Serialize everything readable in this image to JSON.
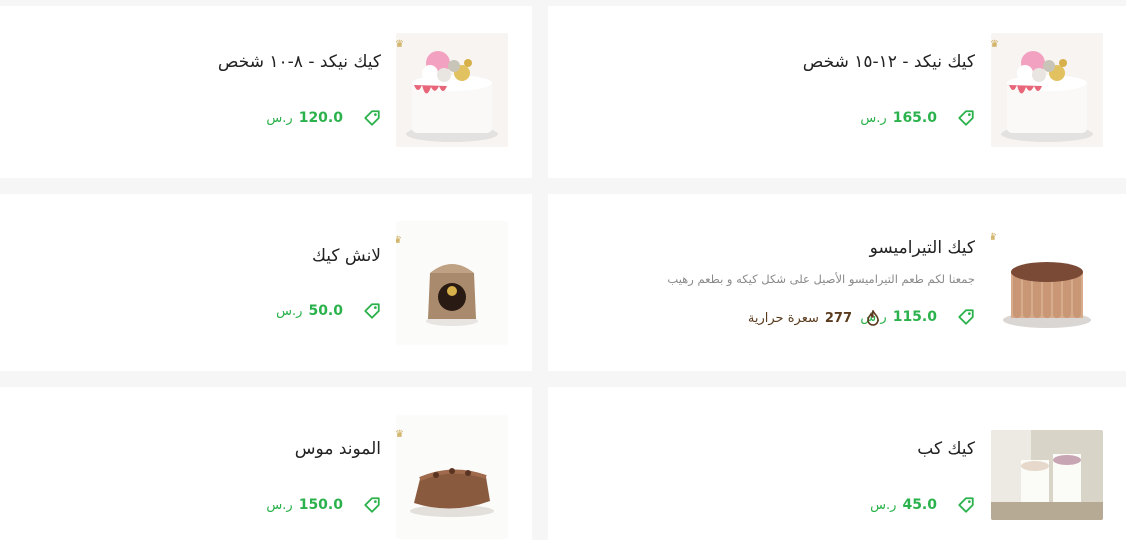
{
  "currency": "ر.س",
  "calorie_unit": "سعرة حرارية",
  "colors": {
    "price": "#2bb24c",
    "calories": "#5a3b1e",
    "title": "#222222",
    "background": "#f6f6f6"
  },
  "products": [
    {
      "name": "كيك نيكد - ١٢-١٥ شخص",
      "price": "165.0",
      "image": "naked-cake-image"
    },
    {
      "name": "كيك نيكد - ٨-١٠ شخص",
      "price": "120.0",
      "image": "naked-cake-image"
    },
    {
      "name": "كيك التيراميسو",
      "description": "جمعنا لكم طعم التيراميسو الأصيل على شكل كيكه و بطعم رهيب",
      "price": "115.0",
      "calories": "277",
      "image": "tiramisu-cake-image"
    },
    {
      "name": "لانش كيك",
      "price": "50.0",
      "image": "lunch-cake-image"
    },
    {
      "name": "كيك كب",
      "price": "45.0",
      "image": "cup-cake-image"
    },
    {
      "name": "الموند موس",
      "price": "150.0",
      "image": "almond-mousse-image"
    }
  ]
}
